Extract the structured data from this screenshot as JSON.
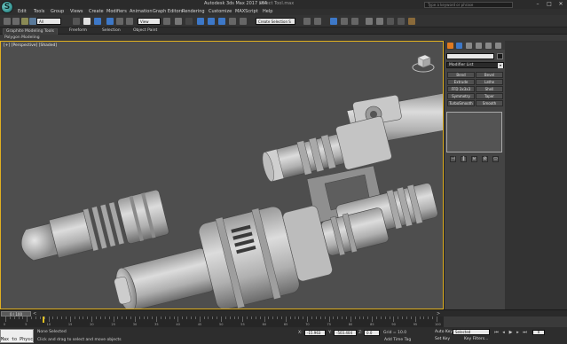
{
  "titlebar": {
    "app_logo": "S",
    "title": "Autodesk 3ds Max 2017 x64",
    "document": "Select Tool.max",
    "search_placeholder": "Type a keyword or phrase",
    "minimize": "–",
    "maximize": "□",
    "close": "✕"
  },
  "menubar": {
    "items": [
      "Edit",
      "Tools",
      "Group",
      "Views",
      "Create",
      "Modifiers",
      "Animation",
      "Graph Editors",
      "Rendering",
      "Customize",
      "MAXScript",
      "Help"
    ]
  },
  "toolbar": {
    "layer_select": "All",
    "view_select": "View",
    "selection_set": "Create Selection S"
  },
  "ribbon": {
    "active_tab": "Graphite Modeling Tools",
    "tabs": [
      "Freeform",
      "Selection",
      "Object Paint"
    ],
    "subtitle": "Polygon Modeling"
  },
  "viewport": {
    "label": "[+] [Perspective] [Shaded]"
  },
  "command_panel": {
    "modifier_list": "Modifier List",
    "buttons": [
      [
        "Bend",
        "Bevel"
      ],
      [
        "Extrude",
        "Lathe"
      ],
      [
        "FFD 3x3x3",
        "Shell"
      ],
      [
        "Symmetry",
        "Taper"
      ],
      [
        "TurboSmooth",
        "Smooth"
      ]
    ],
    "stack_tools": [
      "⊣",
      "‖",
      "⊎",
      "⊘",
      "▭"
    ]
  },
  "timeline": {
    "slider_label": "0 / 100",
    "prev": "<",
    "next": ">",
    "ticks": [
      "0",
      "5",
      "10",
      "15",
      "20",
      "25",
      "30",
      "35",
      "40",
      "45",
      "50",
      "55",
      "60",
      "65",
      "70",
      "75",
      "80",
      "85",
      "90",
      "95",
      "100"
    ]
  },
  "statusbar": {
    "maxscript_label": "Max to Physc.",
    "selection_status": "None Selected",
    "prompt": "Click and drag to select and move objects",
    "x_label": "X:",
    "x_value": "-15.963",
    "y_label": "Y:",
    "y_value": "-503.404",
    "z_label": "Z:",
    "z_value": "0.0",
    "grid": "Grid = 10.0",
    "add_time_tag": "Add Time Tag",
    "auto_key": "Auto Key",
    "set_key": "Set Key",
    "selected": "Selected",
    "key_filters": "Key Filters...",
    "frame": "0"
  }
}
